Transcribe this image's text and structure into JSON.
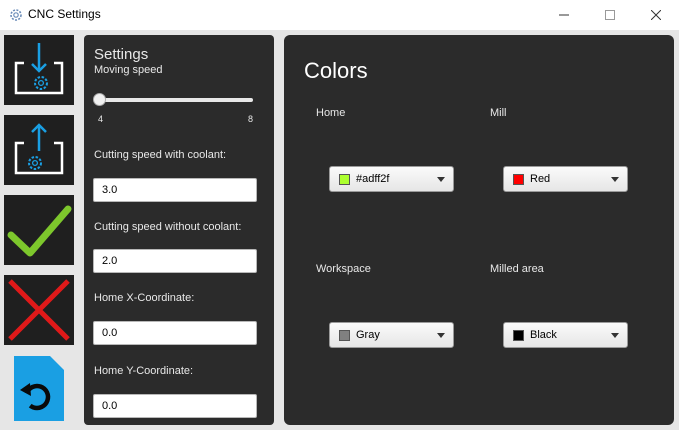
{
  "window": {
    "title": "CNC Settings",
    "icon": "gear-icon",
    "controls": [
      "minimize-icon",
      "maximize-icon",
      "close-icon"
    ]
  },
  "toolbar": {
    "items": [
      {
        "name": "import-settings-button",
        "icon": "download-settings-icon"
      },
      {
        "name": "export-settings-button",
        "icon": "upload-settings-icon"
      },
      {
        "name": "apply-button",
        "icon": "checkmark-icon",
        "color": "#7dc72c"
      },
      {
        "name": "cancel-button",
        "icon": "red-x-icon",
        "color": "#e01919"
      },
      {
        "name": "reset-button",
        "icon": "reset-document-icon",
        "color": "#1a9fe3"
      }
    ]
  },
  "settings": {
    "heading": "Settings",
    "moving_speed": {
      "label": "Moving speed",
      "min": "4",
      "max": "8",
      "value": 4
    },
    "cutting_with_coolant": {
      "label": "Cutting speed with coolant:",
      "value": "3.0"
    },
    "cutting_without_coolant": {
      "label": "Cutting speed without coolant:",
      "value": "2.0"
    },
    "home_x": {
      "label": "Home X-Coordinate:",
      "value": "0.0"
    },
    "home_y": {
      "label": "Home Y-Coordinate:",
      "value": "0.0"
    }
  },
  "colors": {
    "heading": "Colors",
    "home": {
      "label": "Home",
      "value": "#adff2f",
      "swatch": "#adff2f"
    },
    "mill": {
      "label": "Mill",
      "value": "Red",
      "swatch": "#ff0000"
    },
    "workspace": {
      "label": "Workspace",
      "value": "Gray",
      "swatch": "#808080"
    },
    "milled_area": {
      "label": "Milled area",
      "value": "Black",
      "swatch": "#000000"
    }
  }
}
